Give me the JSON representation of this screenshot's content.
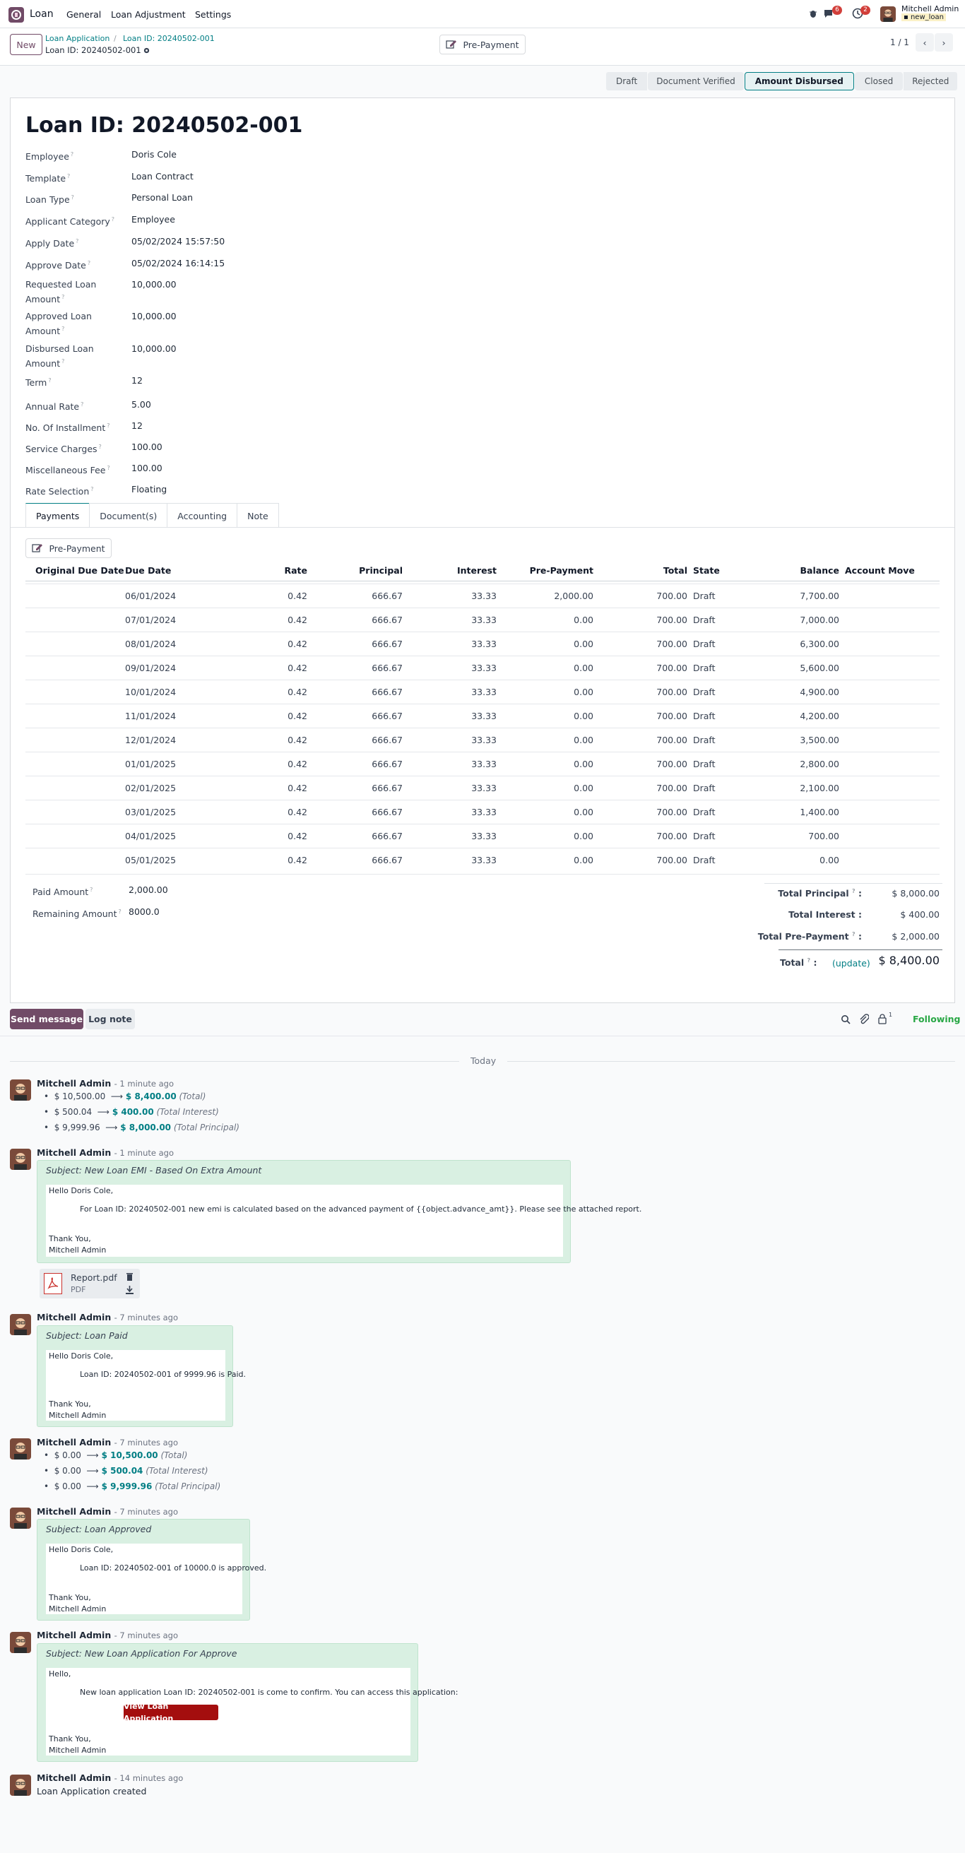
{
  "topbar": {
    "app_name": "Loan",
    "menus": [
      "General",
      "Loan Adjustment",
      "Settings"
    ],
    "messages_badge": "6",
    "activities_badge": "2",
    "user_name": "Mitchell Admin",
    "db_name": "new_loan"
  },
  "control": {
    "new_label": "New",
    "breadcrumb_parent": "Loan Application",
    "breadcrumb_sep": "/",
    "breadcrumb_current": "Loan ID: 20240502-001",
    "record_title": "Loan ID: 20240502-001",
    "prepayment_label": "Pre-Payment",
    "pager": "1 / 1"
  },
  "statusbar": [
    "Draft",
    "Document Verified",
    "Amount Disbursed",
    "Closed",
    "Rejected"
  ],
  "status_active": "Amount Disbursed",
  "form": {
    "title": "Loan ID: 20240502-001",
    "fields": [
      {
        "label": "Employee",
        "value": "Doris Cole"
      },
      {
        "label": "Template",
        "value": "Loan Contract"
      },
      {
        "label": "Loan Type",
        "value": "Personal Loan"
      },
      {
        "label": "Applicant Category",
        "value": "Employee"
      },
      {
        "label": "Apply Date",
        "value": "05/02/2024 15:57:50"
      },
      {
        "label": "Approve Date",
        "value": "05/02/2024 16:14:15"
      },
      {
        "label": "Requested Loan Amount",
        "value": "10,000.00"
      },
      {
        "label": "Approved Loan Amount",
        "value": "10,000.00"
      },
      {
        "label": "Disbursed Loan Amount",
        "value": "10,000.00"
      },
      {
        "label": "Term",
        "value": "12"
      },
      {
        "label": "Annual Rate",
        "value": "5.00"
      },
      {
        "label": "No. Of Installment",
        "value": "12"
      },
      {
        "label": "Service Charges",
        "value": "100.00"
      },
      {
        "label": "Miscellaneous Fee",
        "value": "100.00"
      },
      {
        "label": "Rate Selection",
        "value": "Floating"
      }
    ],
    "help_mark": "?"
  },
  "tabs": [
    "Payments",
    "Document(s)",
    "Accounting",
    "Note"
  ],
  "payments": {
    "prepayment_button": "Pre-Payment",
    "columns": [
      "Original Due Date",
      "Due Date",
      "Rate",
      "Principal",
      "Interest",
      "Pre-Payment",
      "Total",
      "State",
      "Balance",
      "Account Move"
    ],
    "rows": [
      [
        "",
        "06/01/2024",
        "0.42",
        "666.67",
        "33.33",
        "2,000.00",
        "700.00",
        "Draft",
        "7,700.00",
        ""
      ],
      [
        "",
        "07/01/2024",
        "0.42",
        "666.67",
        "33.33",
        "0.00",
        "700.00",
        "Draft",
        "7,000.00",
        ""
      ],
      [
        "",
        "08/01/2024",
        "0.42",
        "666.67",
        "33.33",
        "0.00",
        "700.00",
        "Draft",
        "6,300.00",
        ""
      ],
      [
        "",
        "09/01/2024",
        "0.42",
        "666.67",
        "33.33",
        "0.00",
        "700.00",
        "Draft",
        "5,600.00",
        ""
      ],
      [
        "",
        "10/01/2024",
        "0.42",
        "666.67",
        "33.33",
        "0.00",
        "700.00",
        "Draft",
        "4,900.00",
        ""
      ],
      [
        "",
        "11/01/2024",
        "0.42",
        "666.67",
        "33.33",
        "0.00",
        "700.00",
        "Draft",
        "4,200.00",
        ""
      ],
      [
        "",
        "12/01/2024",
        "0.42",
        "666.67",
        "33.33",
        "0.00",
        "700.00",
        "Draft",
        "3,500.00",
        ""
      ],
      [
        "",
        "01/01/2025",
        "0.42",
        "666.67",
        "33.33",
        "0.00",
        "700.00",
        "Draft",
        "2,800.00",
        ""
      ],
      [
        "",
        "02/01/2025",
        "0.42",
        "666.67",
        "33.33",
        "0.00",
        "700.00",
        "Draft",
        "2,100.00",
        ""
      ],
      [
        "",
        "03/01/2025",
        "0.42",
        "666.67",
        "33.33",
        "0.00",
        "700.00",
        "Draft",
        "1,400.00",
        ""
      ],
      [
        "",
        "04/01/2025",
        "0.42",
        "666.67",
        "33.33",
        "0.00",
        "700.00",
        "Draft",
        "700.00",
        ""
      ],
      [
        "",
        "05/01/2025",
        "0.42",
        "666.67",
        "33.33",
        "0.00",
        "700.00",
        "Draft",
        "0.00",
        ""
      ]
    ],
    "paid_label": "Paid Amount",
    "paid_value": "2,000.00",
    "remaining_label": "Remaining Amount",
    "remaining_value": "8000.0",
    "totals": {
      "principal_label": "Total Principal",
      "principal_value": "$ 8,000.00",
      "interest_label": "Total Interest",
      "interest_value": "$ 400.00",
      "prepayment_label": "Total Pre-Payment",
      "prepayment_value": "$ 2,000.00",
      "total_label": "Total",
      "update_label": "(update)",
      "total_value": "$ 8,400.00"
    }
  },
  "chatter": {
    "send_message": "Send message",
    "log_note": "Log note",
    "followers_count": "1",
    "following": "Following",
    "today": "Today",
    "messages": [
      {
        "author": "Mitchell Admin",
        "ago": "- 1 minute ago",
        "tracking": [
          {
            "old": "$ 10,500.00",
            "new": "$ 8,400.00",
            "field": "(Total)"
          },
          {
            "old": "$ 500.04",
            "new": "$ 400.00",
            "field": "(Total Interest)"
          },
          {
            "old": "$ 9,999.96",
            "new": "$ 8,000.00",
            "field": "(Total Principal)"
          }
        ]
      },
      {
        "author": "Mitchell Admin",
        "ago": "- 1 minute ago",
        "subject": "Subject: New Loan EMI - Based On Extra Amount",
        "greeting": "Hello Doris Cole,",
        "body": "For Loan ID: 20240502-001 new emi is calculated based on the advanced payment of {{object.advance_amt}}. Please see the attached report.",
        "closing": "Thank You,",
        "signature": "Mitchell Admin",
        "attachment_name": "Report.pdf",
        "attachment_type": "PDF"
      },
      {
        "author": "Mitchell Admin",
        "ago": "- 7 minutes ago",
        "subject": "Subject: Loan Paid",
        "greeting": "Hello Doris Cole,",
        "body": "Loan ID: 20240502-001 of 9999.96 is Paid.",
        "closing": "Thank You,",
        "signature": "Mitchell Admin"
      },
      {
        "author": "Mitchell Admin",
        "ago": "- 7 minutes ago",
        "tracking": [
          {
            "old": "$ 0.00",
            "new": "$ 10,500.00",
            "field": "(Total)"
          },
          {
            "old": "$ 0.00",
            "new": "$ 500.04",
            "field": "(Total Interest)"
          },
          {
            "old": "$ 0.00",
            "new": "$ 9,999.96",
            "field": "(Total Principal)"
          }
        ]
      },
      {
        "author": "Mitchell Admin",
        "ago": "- 7 minutes ago",
        "subject": "Subject: Loan Approved",
        "greeting": "Hello Doris Cole,",
        "body": "Loan ID: 20240502-001 of 10000.0 is approved.",
        "closing": "Thank You,",
        "signature": "Mitchell Admin"
      },
      {
        "author": "Mitchell Admin",
        "ago": "- 7 minutes ago",
        "subject": "Subject: New Loan Application For Approve",
        "greeting": "Hello,",
        "body": "New loan application Loan ID: 20240502-001 is come to confirm. You can access this application:",
        "button": "View Loan Application",
        "closing": "Thank You,",
        "signature": "Mitchell Admin"
      },
      {
        "author": "Mitchell Admin",
        "ago": "- 14 minutes ago",
        "text": "Loan Application created"
      }
    ]
  },
  "colors": {
    "brand": "#714b67",
    "accent": "#017e84",
    "mail_bg": "#d9f0e2",
    "button_red": "#a40e0e"
  }
}
